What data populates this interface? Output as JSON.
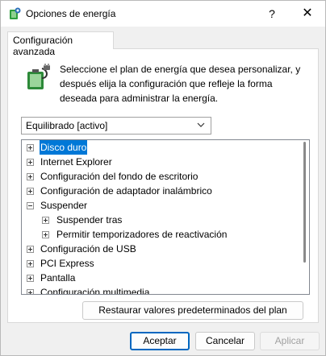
{
  "window": {
    "title": "Opciones de energía",
    "help_glyph": "?",
    "close_glyph": "✕",
    "icon": "power-options-icon"
  },
  "tab": {
    "label": "Configuración avanzada"
  },
  "description": {
    "icon": "battery-plug-icon",
    "lines": [
      "Seleccione el plan de energía que desea personalizar, y",
      "después elija la configuración que refleje la forma",
      "deseada para administrar la energía."
    ]
  },
  "plan_dropdown": {
    "selected": "Equilibrado [activo]",
    "icon": "chevron-down-icon"
  },
  "tree": {
    "items": [
      {
        "label": "Disco duro",
        "expander": "plus",
        "selected": true
      },
      {
        "label": "Internet Explorer",
        "expander": "plus",
        "selected": false
      },
      {
        "label": "Configuración del fondo de escritorio",
        "expander": "plus",
        "selected": false
      },
      {
        "label": "Configuración de adaptador inalámbrico",
        "expander": "plus",
        "selected": false
      },
      {
        "label": "Suspender",
        "expander": "minus",
        "selected": false
      },
      {
        "label": "Suspender tras",
        "expander": "plus",
        "selected": false
      },
      {
        "label": "Permitir temporizadores de reactivación",
        "expander": "plus",
        "selected": false
      },
      {
        "label": "Configuración de USB",
        "expander": "plus",
        "selected": false
      },
      {
        "label": "PCI Express",
        "expander": "plus",
        "selected": false
      },
      {
        "label": "Pantalla",
        "expander": "plus",
        "selected": false
      },
      {
        "label": "Configuración multimedia",
        "expander": "plus",
        "selected": false
      }
    ]
  },
  "buttons": {
    "restore": "Restaurar valores predeterminados del plan",
    "ok": "Aceptar",
    "cancel": "Cancelar",
    "apply": "Aplicar"
  },
  "colors": {
    "selection": "#0078d7",
    "primary_border": "#0067c0"
  }
}
